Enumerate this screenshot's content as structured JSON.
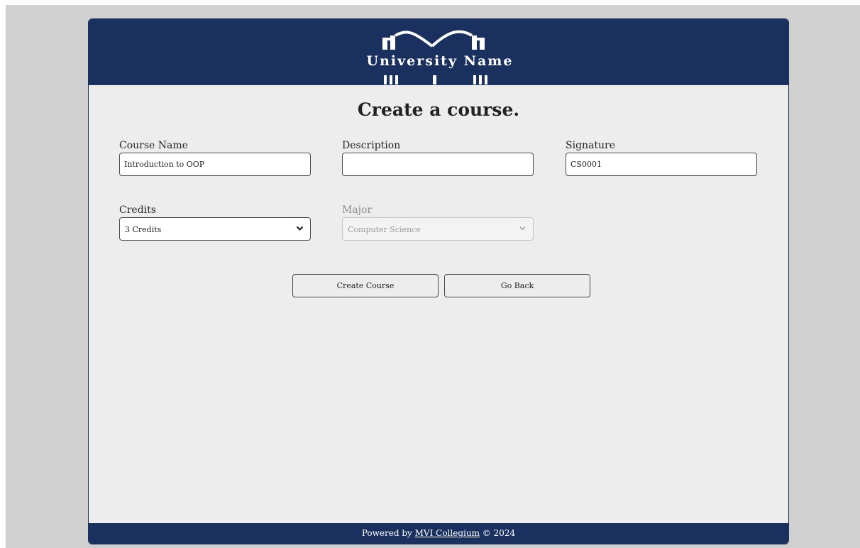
{
  "brand": {
    "name": "University Name",
    "header_color": "#1a3160",
    "logo_icon": "university-building-logo"
  },
  "page": {
    "title": "Create a course."
  },
  "form": {
    "course_name": {
      "label": "Course Name",
      "value": "Introduction to OOP"
    },
    "description": {
      "label": "Description",
      "value": ""
    },
    "signature": {
      "label": "Signature",
      "value": "CS0001"
    },
    "credits": {
      "label": "Credits",
      "selected": "3 Credits",
      "icon": "chevron-down-icon"
    },
    "major": {
      "label": "Major",
      "selected": "Computer Science",
      "disabled": true,
      "icon": "chevron-down-icon"
    }
  },
  "actions": {
    "create_label": "Create Course",
    "back_label": "Go Back"
  },
  "footer": {
    "prefix": "Powered by ",
    "link_text": "MVI Collegium",
    "suffix": " © 2024"
  }
}
